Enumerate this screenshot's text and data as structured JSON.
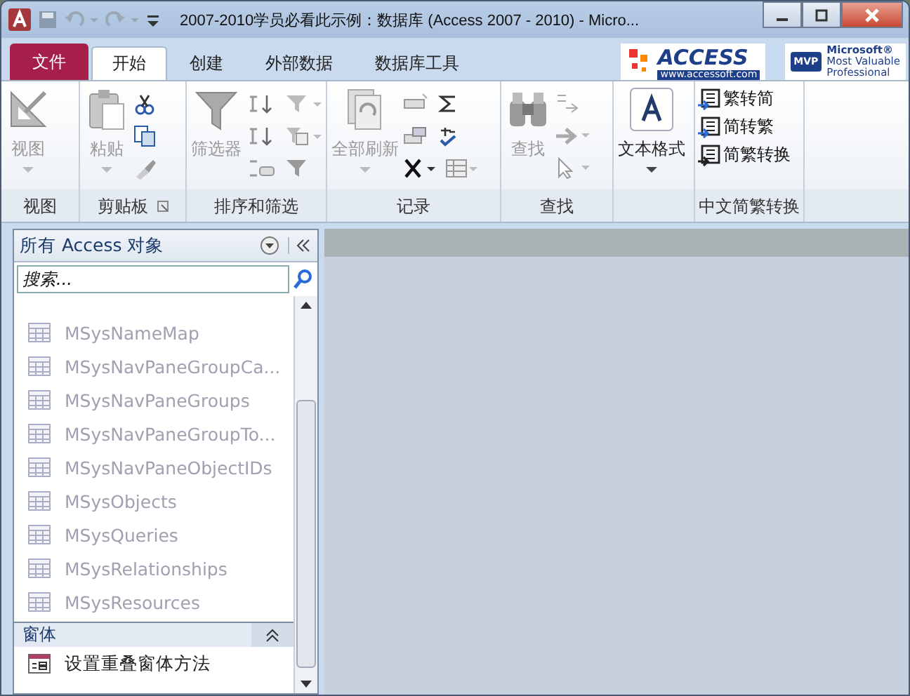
{
  "window": {
    "title": "2007-2010学员必看此示例：数据库 (Access 2007 - 2010)  -  Micro..."
  },
  "tabs": [
    {
      "label": "文件",
      "kind": "file",
      "selected": false
    },
    {
      "label": "开始",
      "kind": "tab",
      "selected": true
    },
    {
      "label": "创建",
      "kind": "tab",
      "selected": false
    },
    {
      "label": "外部数据",
      "kind": "tab",
      "selected": false
    },
    {
      "label": "数据库工具",
      "kind": "tab",
      "selected": false
    }
  ],
  "logos": {
    "access": "ACCESS",
    "access_url": "www.accessoft.com",
    "mvp_badge": "MVP",
    "mvp_lines": [
      "Microsoft®",
      "Most Valuable",
      "Professional"
    ]
  },
  "ribbon": {
    "groups": [
      {
        "label": "视图",
        "big_button": {
          "label": "视图",
          "disabled": true
        }
      },
      {
        "label": "剪贴板",
        "big_button": {
          "label": "粘贴",
          "disabled": true
        }
      },
      {
        "label": "排序和筛选",
        "big_button": {
          "label": "筛选器",
          "disabled": true
        }
      },
      {
        "label": "记录",
        "big_button": {
          "label": "全部刷新",
          "disabled": true
        }
      },
      {
        "label": "查找",
        "big_button": {
          "label": "查找",
          "disabled": true
        }
      },
      {
        "big_button": {
          "label": "文本格式",
          "disabled": false
        }
      },
      {
        "label": "中文简繁转换",
        "commands": [
          "繁转简",
          "简转繁",
          "简繁转换"
        ]
      }
    ]
  },
  "nav_pane": {
    "title": "所有 Access 对象",
    "search": {
      "placeholder": "搜索..."
    },
    "items": [
      {
        "label": "MSysNameMap",
        "kind": "table",
        "disabled": true
      },
      {
        "label": "MSysNavPaneGroupCa...",
        "kind": "table",
        "disabled": true
      },
      {
        "label": "MSysNavPaneGroups",
        "kind": "table",
        "disabled": true
      },
      {
        "label": "MSysNavPaneGroupTo...",
        "kind": "table",
        "disabled": true
      },
      {
        "label": "MSysNavPaneObjectIDs",
        "kind": "table",
        "disabled": true
      },
      {
        "label": "MSysObjects",
        "kind": "table",
        "disabled": true
      },
      {
        "label": "MSysQueries",
        "kind": "table",
        "disabled": true
      },
      {
        "label": "MSysRelationships",
        "kind": "table",
        "disabled": true
      },
      {
        "label": "MSysResources",
        "kind": "table",
        "disabled": true
      },
      {
        "label": "窗体",
        "kind": "group",
        "expanded": true
      },
      {
        "label": "设置重叠窗体方法",
        "kind": "form",
        "disabled": false
      }
    ]
  }
}
